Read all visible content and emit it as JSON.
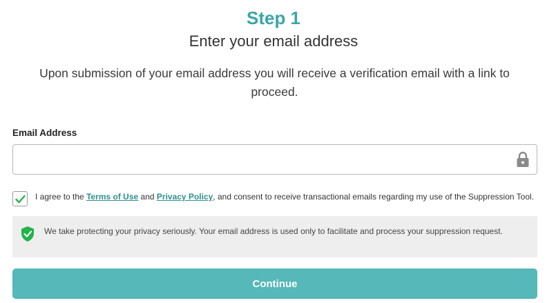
{
  "header": {
    "step": "Step 1",
    "subtitle": "Enter your email address"
  },
  "description": "Upon submission of your email address you will receive a verification email with a link to proceed.",
  "email_field": {
    "label": "Email Address",
    "value": "",
    "placeholder": "",
    "icon": "lock-icon"
  },
  "consent": {
    "checked": true,
    "text_before": "I agree to the ",
    "terms_link": "Terms of Use",
    "text_and": " and ",
    "privacy_link": "Privacy Policy",
    "text_after": ", and consent to receive transactional emails regarding my use of the Suppression Tool."
  },
  "privacy_notice": {
    "icon": "shield-check-icon",
    "text": "We take protecting your privacy seriously. Your email address is used only to facilitate and process your suppression request."
  },
  "continue_button": {
    "label": "Continue"
  },
  "colors": {
    "accent": "#3aa6a6",
    "button": "#56b8b8",
    "check": "#22b34a",
    "shield": "#22b34a",
    "notice_bg": "#eeeeee"
  }
}
